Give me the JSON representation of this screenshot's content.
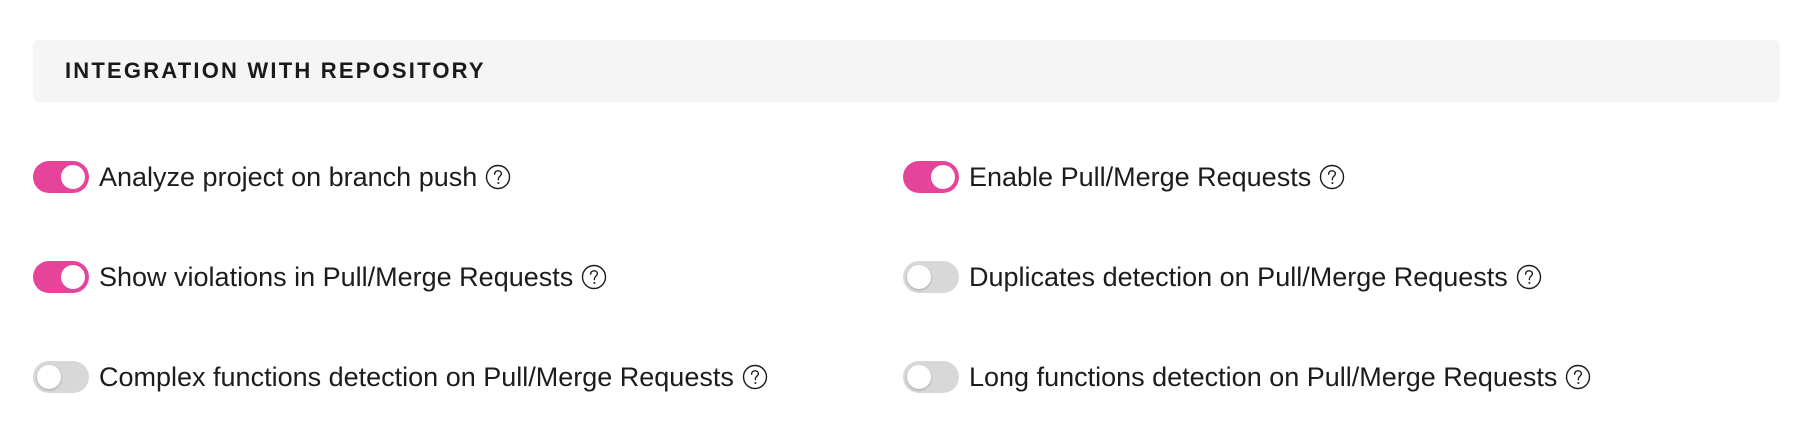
{
  "section": {
    "title": "INTEGRATION WITH REPOSITORY"
  },
  "options": [
    {
      "label": "Analyze project on branch push",
      "enabled": true,
      "icon": "question-circle-icon"
    },
    {
      "label": "Enable Pull/Merge Requests",
      "enabled": true,
      "icon": "question-circle-icon"
    },
    {
      "label": "Show violations in Pull/Merge Requests",
      "enabled": true,
      "icon": "question-circle-icon"
    },
    {
      "label": "Duplicates detection on Pull/Merge Requests",
      "enabled": false,
      "icon": "question-circle-icon"
    },
    {
      "label": "Complex functions detection on Pull/Merge Requests",
      "enabled": false,
      "icon": "question-circle-icon"
    },
    {
      "label": "Long functions detection on Pull/Merge Requests",
      "enabled": false,
      "icon": "question-circle-icon"
    }
  ],
  "colors": {
    "toggle_on": "#e6449b",
    "toggle_off": "#d8d8d8",
    "header_bg": "#f5f5f5"
  }
}
